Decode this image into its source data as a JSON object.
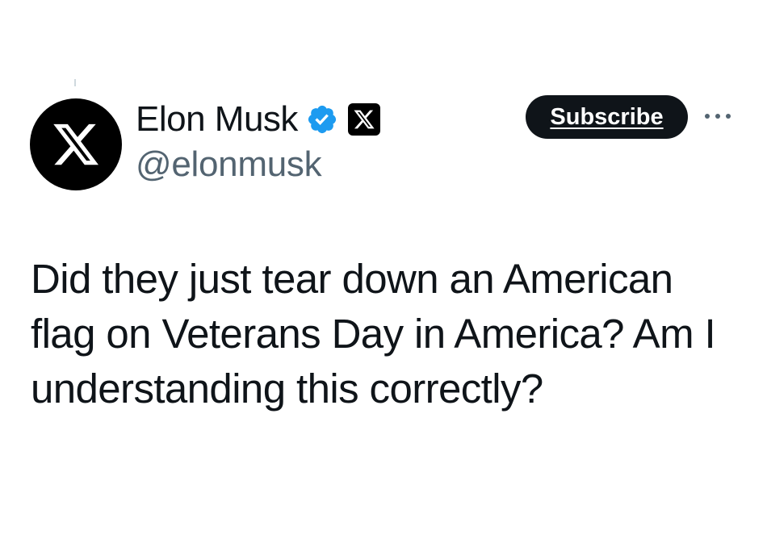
{
  "tweet": {
    "author": {
      "display_name": "Elon Musk",
      "handle": "@elonmusk",
      "avatar_icon": "x-logo-icon",
      "verified_icon": "verified-badge-icon",
      "affiliate_icon": "x-affiliate-badge-icon"
    },
    "subscribe_label": "Subscribe",
    "more_icon": "more-options-icon",
    "text": "Did they just tear down an American flag on Veterans Day in America? Am I understanding this correctly?"
  },
  "colors": {
    "text_primary": "#0f1419",
    "text_secondary": "#536471",
    "verified_blue": "#1d9bf0",
    "button_bg": "#0f1419",
    "background": "#ffffff"
  }
}
